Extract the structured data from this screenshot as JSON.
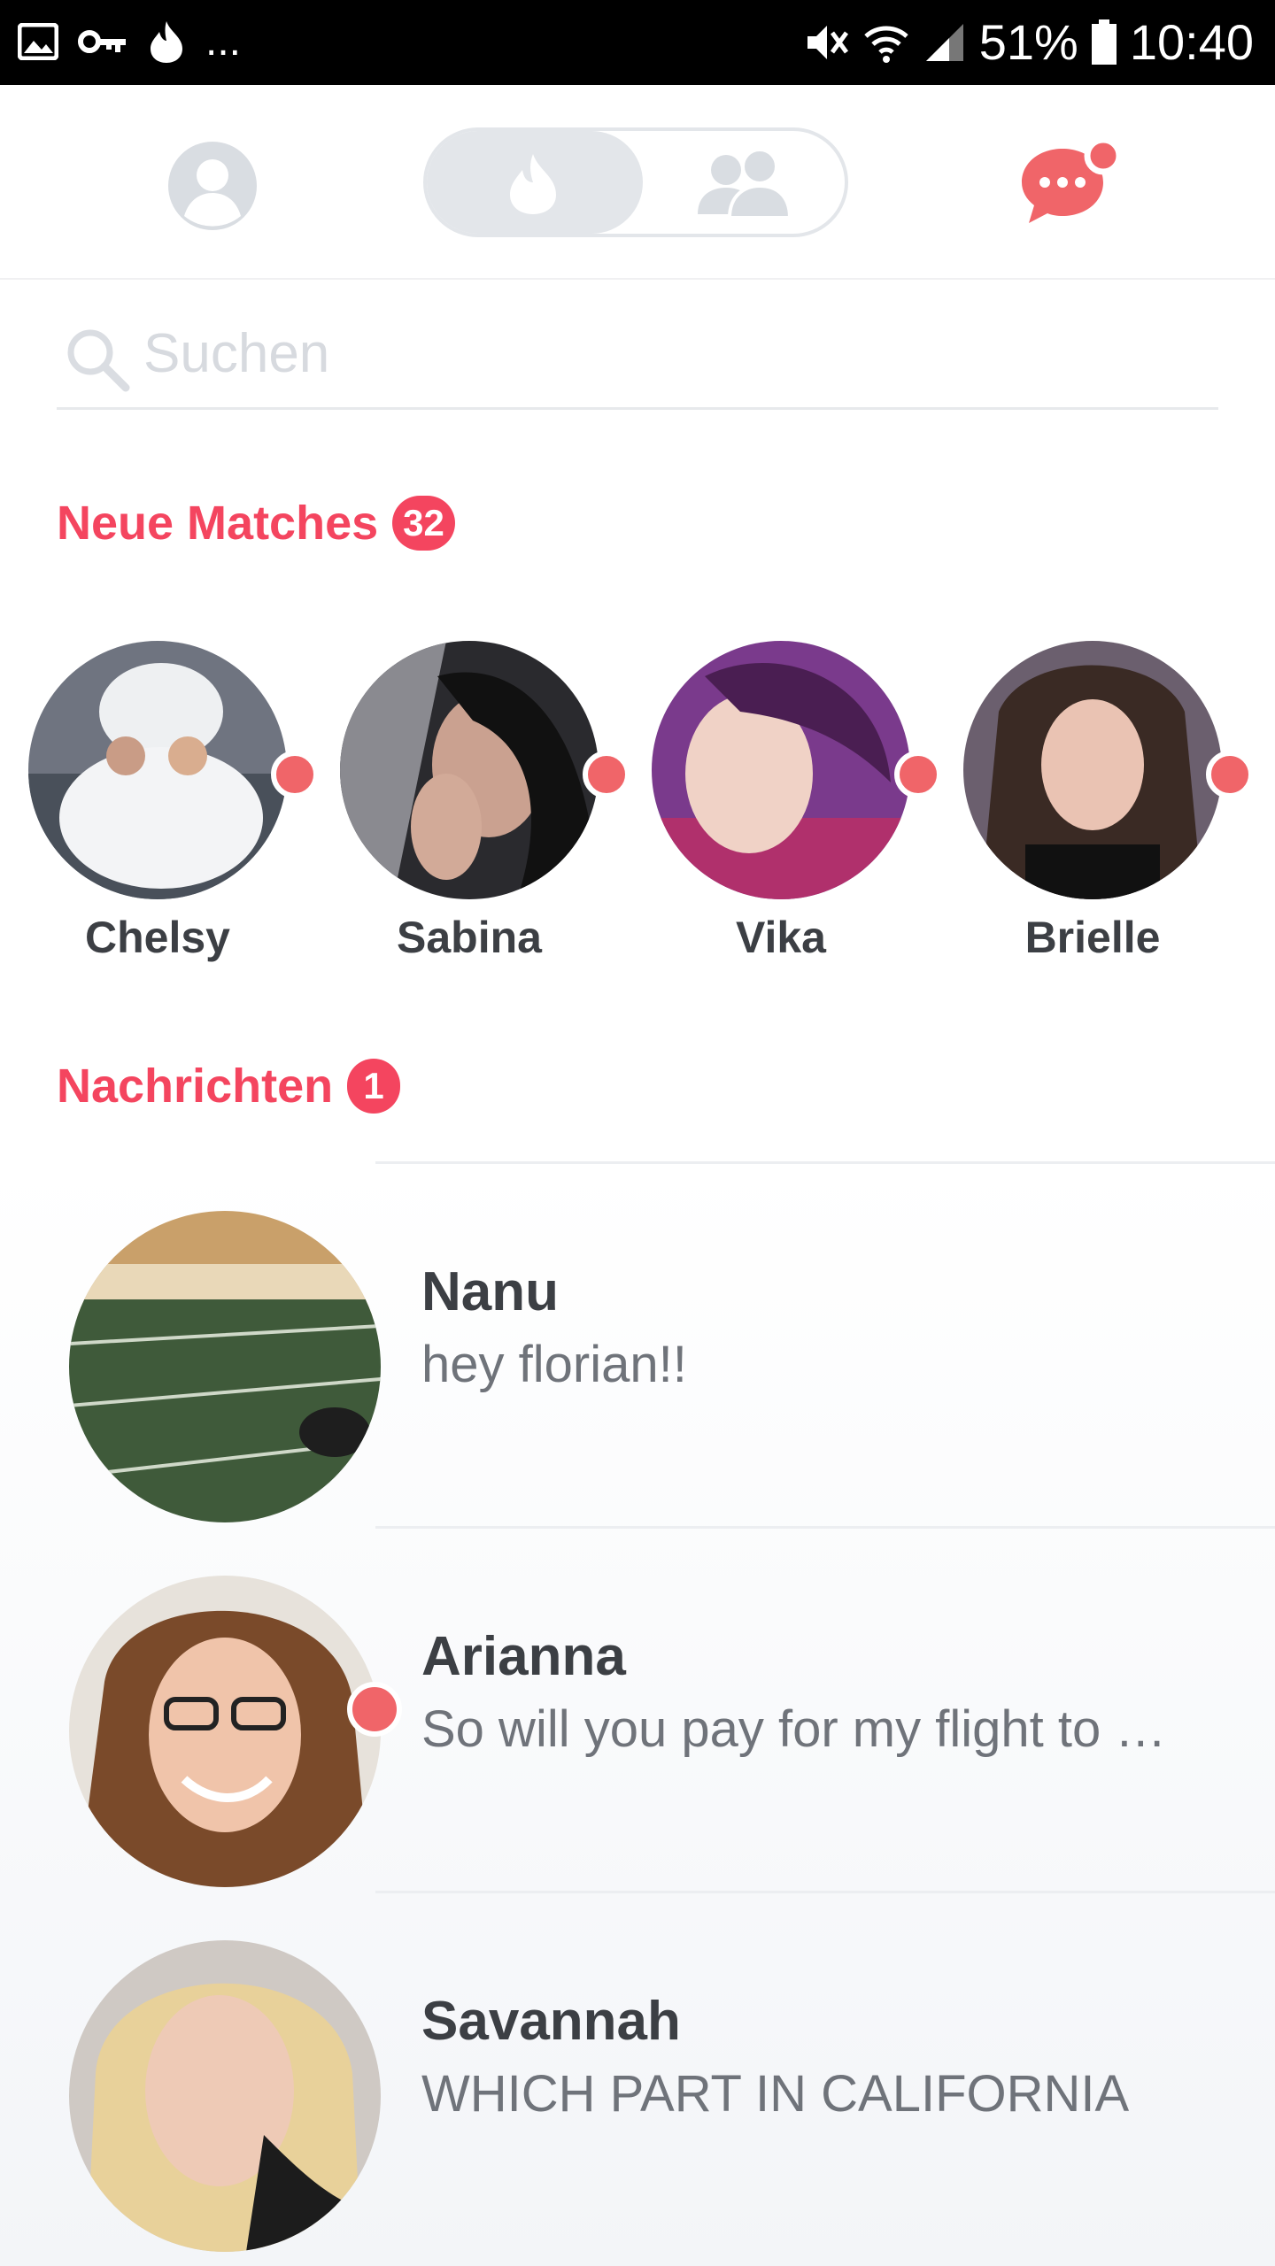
{
  "status_bar": {
    "battery": "51%",
    "time": "10:40",
    "more": "..."
  },
  "header": {
    "tabs": [
      "swipe",
      "social"
    ],
    "chat_has_notification": true
  },
  "search": {
    "placeholder": "Suchen",
    "value": ""
  },
  "new_matches": {
    "title": "Neue Matches",
    "count": "32",
    "items": [
      {
        "name": "Chelsy"
      },
      {
        "name": "Sabina"
      },
      {
        "name": "Vika"
      },
      {
        "name": "Brielle"
      }
    ]
  },
  "messages": {
    "title": "Nachrichten",
    "count": "1",
    "items": [
      {
        "name": "Nanu",
        "preview": "hey florian!!",
        "unread": false
      },
      {
        "name": "Arianna",
        "preview": "So will you pay for my flight to …",
        "unread": true
      },
      {
        "name": "Savannah",
        "preview": "WHICH PART IN CALIFORNIA",
        "unread": false
      }
    ]
  },
  "colors": {
    "accent": "#f4455f",
    "dot": "#f06569",
    "toggle_bg": "#e3e6ea",
    "text_dark": "#3c3f44"
  },
  "icons": [
    "picture-icon",
    "key-icon",
    "flame-icon",
    "mute-icon",
    "wifi-icon",
    "signal-icon",
    "battery-icon",
    "profile-icon",
    "group-icon",
    "chat-icon",
    "search-icon"
  ]
}
